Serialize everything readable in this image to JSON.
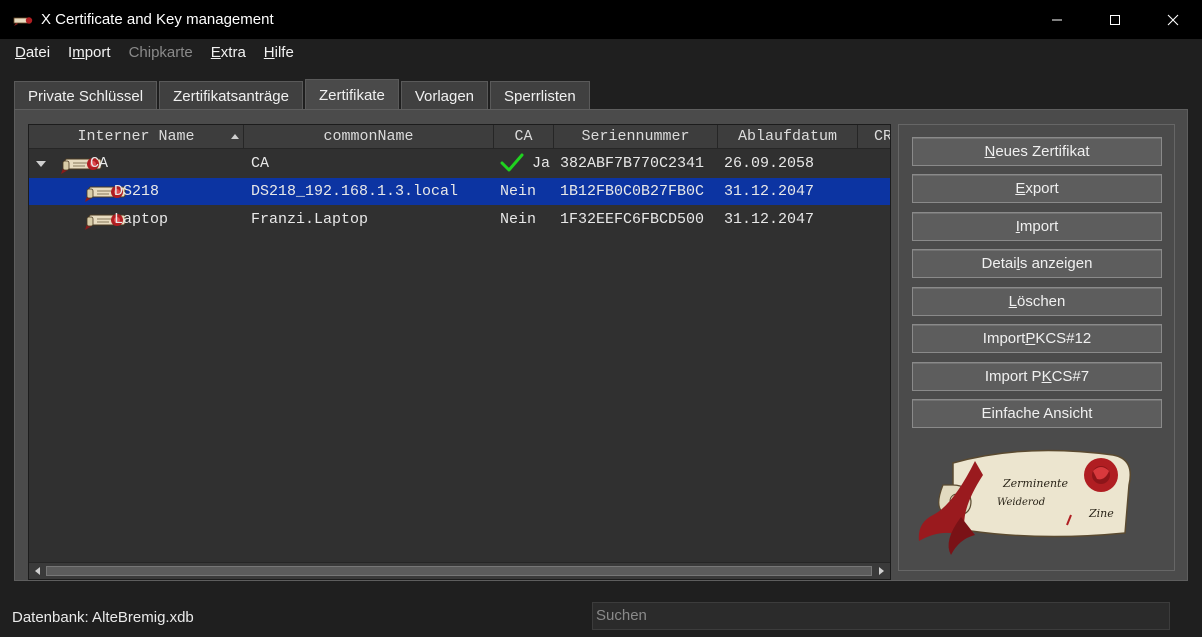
{
  "window": {
    "title": "X Certificate and Key management"
  },
  "menu": {
    "items": [
      {
        "pre": "",
        "u": "D",
        "post": "atei",
        "disabled": false
      },
      {
        "pre": "I",
        "u": "m",
        "post": "port",
        "disabled": false
      },
      {
        "pre": "",
        "u": "",
        "post": "Chipkarte",
        "disabled": true
      },
      {
        "pre": "",
        "u": "E",
        "post": "xtra",
        "disabled": false
      },
      {
        "pre": "",
        "u": "H",
        "post": "ilfe",
        "disabled": false
      }
    ]
  },
  "tabs": [
    {
      "label": "Private Schlüssel",
      "active": false
    },
    {
      "label": "Zertifikatsanträge",
      "active": false
    },
    {
      "label": "Zertifikate",
      "active": true
    },
    {
      "label": "Vorlagen",
      "active": false
    },
    {
      "label": "Sperrlisten",
      "active": false
    }
  ],
  "table": {
    "columns": [
      "Interner Name",
      "commonName",
      "CA",
      "Seriennummer",
      "Ablaufdatum",
      "CR"
    ],
    "sort_column": "Interner Name",
    "rows": [
      {
        "name": "CA",
        "cn": "CA",
        "ca": "Ja",
        "ca_check": true,
        "serial": "382ABF7B770C2341",
        "expiry": "26.09.2058",
        "level": 0,
        "expanded": true,
        "selected": false
      },
      {
        "name": "DS218",
        "cn": "DS218_192.168.1.3.local",
        "ca": "Nein",
        "ca_check": false,
        "serial": "1B12FB0C0B27FB0C",
        "expiry": "31.12.2047",
        "level": 1,
        "expanded": false,
        "selected": true
      },
      {
        "name": "Laptop",
        "cn": "Franzi.Laptop",
        "ca": "Nein",
        "ca_check": false,
        "serial": "1F32EEFC6FBCD500",
        "expiry": "31.12.2047",
        "level": 1,
        "expanded": false,
        "selected": false
      }
    ]
  },
  "buttons": [
    {
      "pre": "",
      "u": "N",
      "post": "eues Zertifikat"
    },
    {
      "pre": "",
      "u": "E",
      "post": "xport"
    },
    {
      "pre": "",
      "u": "I",
      "post": "mport"
    },
    {
      "pre": "Detai",
      "u": "l",
      "post": "s anzeigen"
    },
    {
      "pre": "",
      "u": "L",
      "post": "öschen"
    },
    {
      "pre": "Import ",
      "u": "P",
      "post": "KCS#12"
    },
    {
      "pre": "Import P",
      "u": "K",
      "post": "CS#7"
    },
    {
      "pre": "",
      "u": "",
      "post": "Einfache Ansicht"
    }
  ],
  "status": {
    "database": "Datenbank: AlteBremig.xdb",
    "search_placeholder": "Suchen"
  },
  "colors": {
    "selection": "#0c34a2",
    "check": "#1fd21f",
    "seal": "#b01e22"
  }
}
